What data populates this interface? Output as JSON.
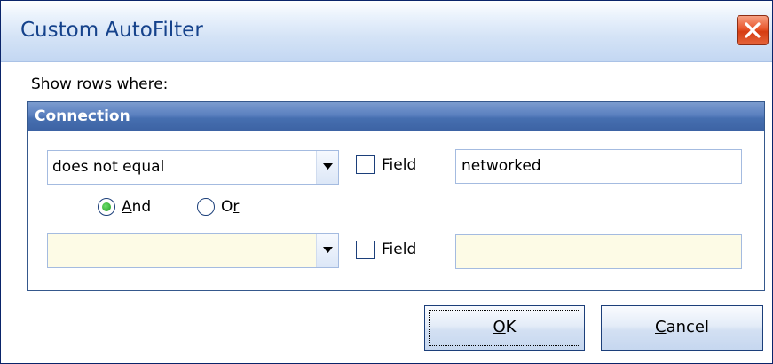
{
  "window": {
    "title": "Custom AutoFilter",
    "close_icon": "close-x-icon",
    "close_color": "#e04a1f"
  },
  "prompt": "Show rows where:",
  "group": {
    "title": "Connection",
    "header_color": "#4a72b4"
  },
  "condition1": {
    "operator": "does not equal",
    "field_label": "Field",
    "field_checked": false,
    "value": "networked",
    "dropdown_icon": "chevron-down-icon"
  },
  "logic": {
    "and_label_mnemonic": "A",
    "and_label_rest": "nd",
    "or_label_start": "O",
    "or_label_mnemonic": "r",
    "selected": "And"
  },
  "condition2": {
    "operator": "",
    "field_label": "Field",
    "field_checked": false,
    "value": "",
    "background": "#fdfbe6",
    "dropdown_icon": "chevron-down-icon"
  },
  "buttons": {
    "ok_mnemonic": "O",
    "ok_rest": "K",
    "cancel_mnemonic": "C",
    "cancel_rest": "ancel"
  }
}
